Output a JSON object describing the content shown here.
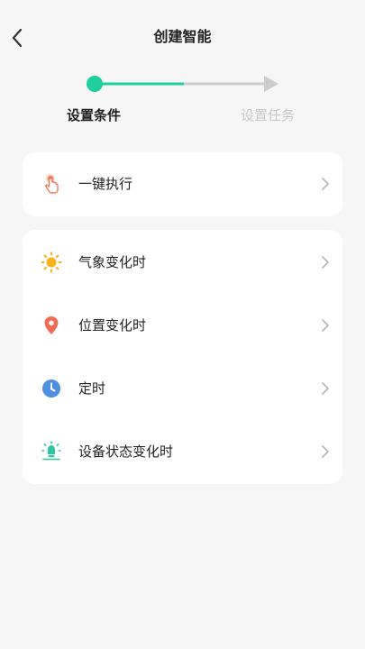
{
  "header": {
    "title": "创建智能"
  },
  "stepper": {
    "steps": [
      {
        "label": "设置条件",
        "state": "active"
      },
      {
        "label": "设置任务",
        "state": "inactive"
      }
    ],
    "accent_color": "#1fcfa0",
    "inactive_color": "#cccccc"
  },
  "conditions": {
    "manual": {
      "label": "一键执行",
      "icon": "tap-hand-icon",
      "icon_color": "#f07a5a"
    },
    "items": [
      {
        "label": "气象变化时",
        "icon": "sun-icon",
        "icon_color": "#f7b21c"
      },
      {
        "label": "位置变化时",
        "icon": "location-pin-icon",
        "icon_color": "#f26b55"
      },
      {
        "label": "定时",
        "icon": "clock-icon",
        "icon_color": "#4f8fe0"
      },
      {
        "label": "设备状态变化时",
        "icon": "device-bulb-icon",
        "icon_color": "#2ec7a3"
      }
    ]
  }
}
